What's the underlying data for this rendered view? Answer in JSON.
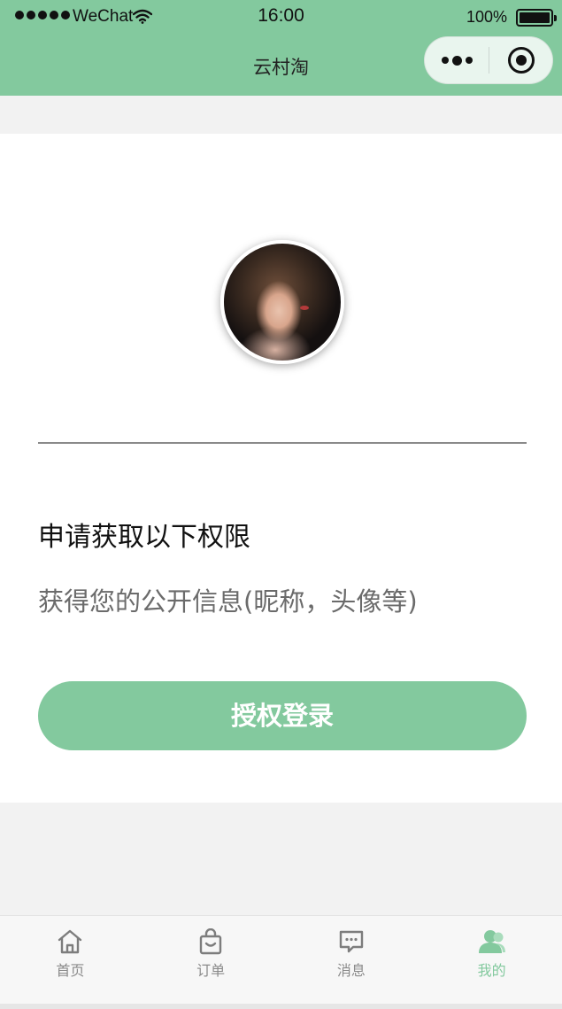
{
  "status_bar": {
    "carrier": "WeChat",
    "time": "16:00",
    "battery": "100%",
    "battery_level": 1.0
  },
  "nav": {
    "title": "云村淘",
    "more_icon": "more-dots-icon",
    "close_icon": "target-close-icon"
  },
  "auth": {
    "permission_title": "申请获取以下权限",
    "permission_desc": "获得您的公开信息(昵称，头像等)",
    "login_button": "授权登录"
  },
  "tabbar": {
    "items": [
      {
        "label": "首页",
        "icon": "home-icon",
        "active": false
      },
      {
        "label": "订单",
        "icon": "shopping-bag-icon",
        "active": false
      },
      {
        "label": "消息",
        "icon": "message-icon",
        "active": false
      },
      {
        "label": "我的",
        "icon": "user-icon",
        "active": true
      }
    ]
  },
  "colors": {
    "brand": "#83c99e",
    "inactive": "#8a8a8a"
  }
}
